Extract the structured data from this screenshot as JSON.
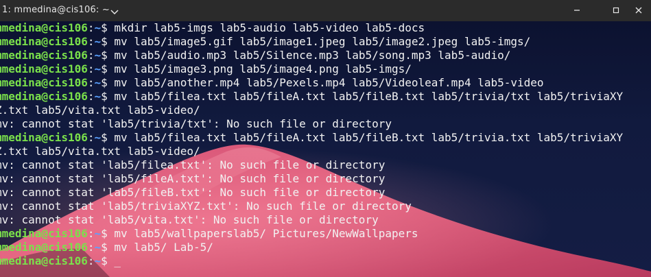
{
  "window": {
    "tab_title": "1: mmedina@cis106: ~",
    "icons": {
      "tab_menu": "chevron-down-icon",
      "minimize": "minimize-icon",
      "maximize": "maximize-icon",
      "close": "close-icon"
    }
  },
  "terminal": {
    "lines": [
      {
        "type": "prompt",
        "user": "mmedina@cis106",
        "sep": ":",
        "path": "~",
        "sym": "$ ",
        "cmd": "mkdir lab5-imgs lab5-audio lab5-video lab5-docs"
      },
      {
        "type": "prompt",
        "user": "mmedina@cis106",
        "sep": ":",
        "path": "~",
        "sym": "$ ",
        "cmd": "mv lab5/image5.gif lab5/image1.jpeg lab5/image2.jpeg lab5-imgs/"
      },
      {
        "type": "prompt",
        "user": "mmedina@cis106",
        "sep": ":",
        "path": "~",
        "sym": "$ ",
        "cmd": "mv lab5/audio.mp3 lab5/Silence.mp3 lab5/song.mp3 lab5-audio/"
      },
      {
        "type": "prompt",
        "user": "mmedina@cis106",
        "sep": ":",
        "path": "~",
        "sym": "$ ",
        "cmd": "mv lab5/image3.png lab5/image4.png lab5-imgs/"
      },
      {
        "type": "prompt",
        "user": "mmedina@cis106",
        "sep": ":",
        "path": "~",
        "sym": "$ ",
        "cmd": "mv lab5/another.mp4 lab5/Pexels.mp4 lab5/Videoleaf.mp4 lab5-video"
      },
      {
        "type": "prompt",
        "user": "mmedina@cis106",
        "sep": ":",
        "path": "~",
        "sym": "$ ",
        "cmd": "mv lab5/filea.txt lab5/fileA.txt lab5/fileB.txt lab5/trivia/txt lab5/triviaXY"
      },
      {
        "type": "output",
        "text": "Z.txt lab5/vita.txt lab5-video/"
      },
      {
        "type": "output",
        "text": "mv: cannot stat 'lab5/trivia/txt': No such file or directory"
      },
      {
        "type": "prompt",
        "user": "mmedina@cis106",
        "sep": ":",
        "path": "~",
        "sym": "$ ",
        "cmd": "mv lab5/filea.txt lab5/fileA.txt lab5/fileB.txt lab5/trivia.txt lab5/triviaXY"
      },
      {
        "type": "output",
        "text": "Z.txt lab5/vita.txt lab5-video/"
      },
      {
        "type": "output",
        "text": "mv: cannot stat 'lab5/filea.txt': No such file or directory"
      },
      {
        "type": "output",
        "text": "mv: cannot stat 'lab5/fileA.txt': No such file or directory"
      },
      {
        "type": "output",
        "text": "mv: cannot stat 'lab5/fileB.txt': No such file or directory"
      },
      {
        "type": "output",
        "text": "mv: cannot stat 'lab5/triviaXYZ.txt': No such file or directory"
      },
      {
        "type": "output",
        "text": "mv: cannot stat 'lab5/vita.txt': No such file or directory"
      },
      {
        "type": "prompt",
        "user": "mmedina@cis106",
        "sep": ":",
        "path": "~",
        "sym": "$ ",
        "cmd": "mv lab5/wallpaperslab5/ Pictures/NewWallpapers"
      },
      {
        "type": "prompt",
        "user": "mmedina@cis106",
        "sep": ":",
        "path": "~",
        "sym": "$ ",
        "cmd": "mv lab5/ Lab-5/"
      },
      {
        "type": "prompt",
        "user": "mmedina@cis106",
        "sep": ":",
        "path": "~",
        "sym": "$ ",
        "cmd": "",
        "cursor": "_"
      }
    ]
  },
  "colors": {
    "titlebar": "#2b2b2b",
    "terminal_bg": "#0e1430",
    "user": "#7be14b",
    "path": "#5aa1ff",
    "text": "#f2f2f2",
    "wallpaper_accent": "#e0577a"
  }
}
